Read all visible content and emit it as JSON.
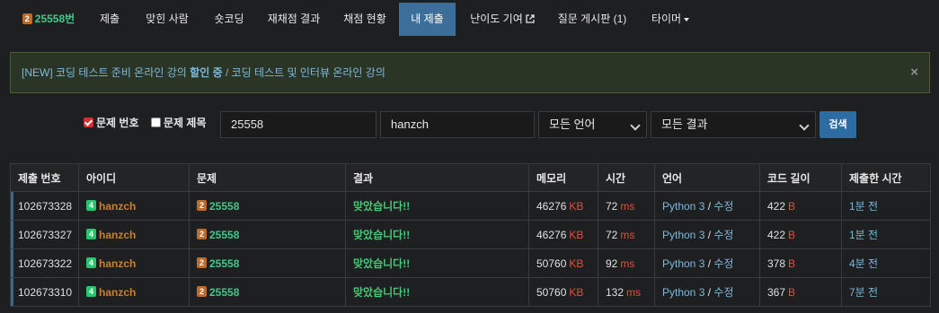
{
  "nav": {
    "problem_id": "25558번",
    "problem_tier": "2",
    "items": [
      "제출",
      "맞힌 사람",
      "숏코딩",
      "재채점 결과",
      "채점 현황",
      "내 제출",
      "난이도 기여",
      "질문 게시판 (1)",
      "타이머"
    ],
    "active": "내 제출"
  },
  "alert": {
    "part1": "[NEW] 코딩 테스트 준비 온라인 강의 ",
    "part1_bold": "할인 중",
    "separator": " / ",
    "part2": "코딩 테스트 및 인터뷰 온라인 강의",
    "close": "×"
  },
  "filter": {
    "problem_number_label": "문제 번호",
    "problem_number_checked": true,
    "problem_title_label": "문제 제목",
    "problem_title_checked": false,
    "problem_value": "25558",
    "user_value": "hanzch",
    "language": "모든 언어",
    "result": "모든 결과",
    "search_label": "검색"
  },
  "table": {
    "headers": [
      "제출 번호",
      "아이디",
      "문제",
      "결과",
      "메모리",
      "시간",
      "언어",
      "코드 길이",
      "제출한 시간"
    ],
    "rows": [
      {
        "id": "102673328",
        "user": "hanzch",
        "user_tier": "4",
        "problem": "25558",
        "problem_tier": "2",
        "result": "맞았습니다!!",
        "memory": "46276",
        "memory_unit": "KB",
        "time": "72",
        "time_unit": "ms",
        "language": "Python 3",
        "edit": "수정",
        "code_length": "422",
        "length_unit": "B",
        "submitted": "1분 전"
      },
      {
        "id": "102673327",
        "user": "hanzch",
        "user_tier": "4",
        "problem": "25558",
        "problem_tier": "2",
        "result": "맞았습니다!!",
        "memory": "46276",
        "memory_unit": "KB",
        "time": "72",
        "time_unit": "ms",
        "language": "Python 3",
        "edit": "수정",
        "code_length": "422",
        "length_unit": "B",
        "submitted": "1분 전"
      },
      {
        "id": "102673322",
        "user": "hanzch",
        "user_tier": "4",
        "problem": "25558",
        "problem_tier": "2",
        "result": "맞았습니다!!",
        "memory": "50760",
        "memory_unit": "KB",
        "time": "92",
        "time_unit": "ms",
        "language": "Python 3",
        "edit": "수정",
        "code_length": "378",
        "length_unit": "B",
        "submitted": "4분 전"
      },
      {
        "id": "102673310",
        "user": "hanzch",
        "user_tier": "4",
        "problem": "25558",
        "problem_tier": "2",
        "result": "맞았습니다!!",
        "memory": "50760",
        "memory_unit": "KB",
        "time": "132",
        "time_unit": "ms",
        "language": "Python 3",
        "edit": "수정",
        "code_length": "367",
        "length_unit": "B",
        "submitted": "7분 전"
      }
    ]
  },
  "colors": {
    "background": "#1e1f21",
    "active_tab": "#3b6f9a",
    "accepted": "#48c774",
    "link": "#7eb8d9",
    "unit_red": "#e74c3c",
    "user_orange": "#c97f2c",
    "bronze_tier": "#c16a27",
    "green_tier": "#2bc572"
  }
}
